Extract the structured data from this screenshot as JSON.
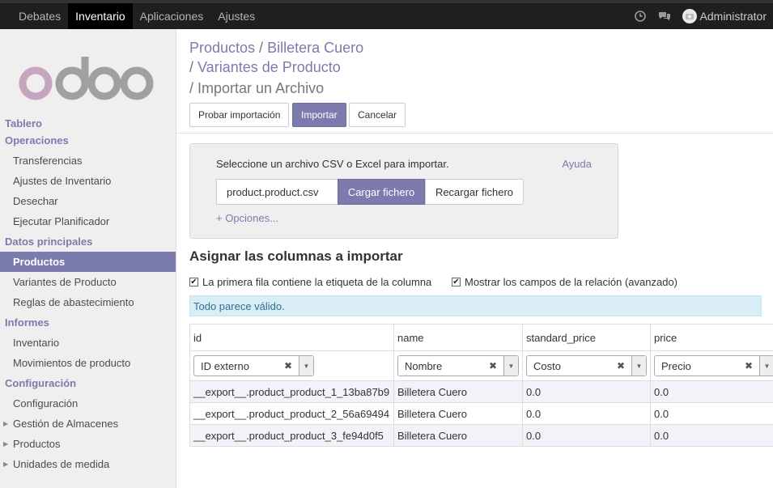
{
  "topbar": {
    "menu": [
      "Debates",
      "Inventario",
      "Aplicaciones",
      "Ajustes"
    ],
    "active_index": 1,
    "user": "Administrator"
  },
  "sidebar": {
    "groups": [
      {
        "title": "Tablero",
        "items": []
      },
      {
        "title": "Operaciones",
        "items": [
          {
            "label": "Transferencias"
          },
          {
            "label": "Ajustes de Inventario"
          },
          {
            "label": "Desechar"
          },
          {
            "label": "Ejecutar Planificador"
          }
        ]
      },
      {
        "title": "Datos principales",
        "items": [
          {
            "label": "Productos",
            "active": true
          },
          {
            "label": "Variantes de Producto"
          },
          {
            "label": "Reglas de abastecimiento"
          }
        ]
      },
      {
        "title": "Informes",
        "items": [
          {
            "label": "Inventario"
          },
          {
            "label": "Movimientos de producto"
          }
        ]
      },
      {
        "title": "Configuración",
        "items": [
          {
            "label": "Configuración"
          },
          {
            "label": "Gestión de Almacenes",
            "expandable": true
          },
          {
            "label": "Productos",
            "expandable": true
          },
          {
            "label": "Unidades de medida",
            "expandable": true
          }
        ]
      }
    ]
  },
  "breadcrumb": {
    "crumb1": "Productos",
    "crumb2": "Billetera Cuero",
    "crumb3": "Variantes de Producto",
    "current": "Importar un Archivo"
  },
  "buttons": {
    "test": "Probar importación",
    "import": "Importar",
    "cancel": "Cancelar"
  },
  "import_box": {
    "label": "Seleccione un archivo CSV o Excel para importar.",
    "help": "Ayuda",
    "file_name": "product.product.csv",
    "load": "Cargar fichero",
    "reload": "Recargar fichero",
    "options": "+ Opciones..."
  },
  "mapping": {
    "title": "Asignar las columnas a importar",
    "first_row_label": "La primera fila contiene la etiqueta de la columna",
    "show_relations_label": "Mostrar los campos de la relación (avanzado)",
    "status": "Todo parece válido."
  },
  "table": {
    "headers": [
      "id",
      "name",
      "standard_price",
      "price"
    ],
    "fields": [
      "ID externo",
      "Nombre",
      "Costo",
      "Precio"
    ],
    "rows": [
      [
        "__export__.product_product_1_13ba87b9",
        "Billetera Cuero",
        "0.0",
        "0.0"
      ],
      [
        "__export__.product_product_2_56a69494",
        "Billetera Cuero",
        "0.0",
        "0.0"
      ],
      [
        "__export__.product_product_3_fe94d0f5",
        "Billetera Cuero",
        "0.0",
        "0.0"
      ]
    ]
  },
  "colors": {
    "accent": "#7c7bad",
    "logo_o": "#c6a5bf",
    "logo_rest": "#a0a0a0",
    "info_bg": "#d9edf7"
  },
  "icons": [
    "clock-icon",
    "chat-icon",
    "user-avatar-icon",
    "checkbox-checked-icon",
    "clear-icon",
    "dropdown-arrow-icon",
    "expand-caret-icon"
  ]
}
